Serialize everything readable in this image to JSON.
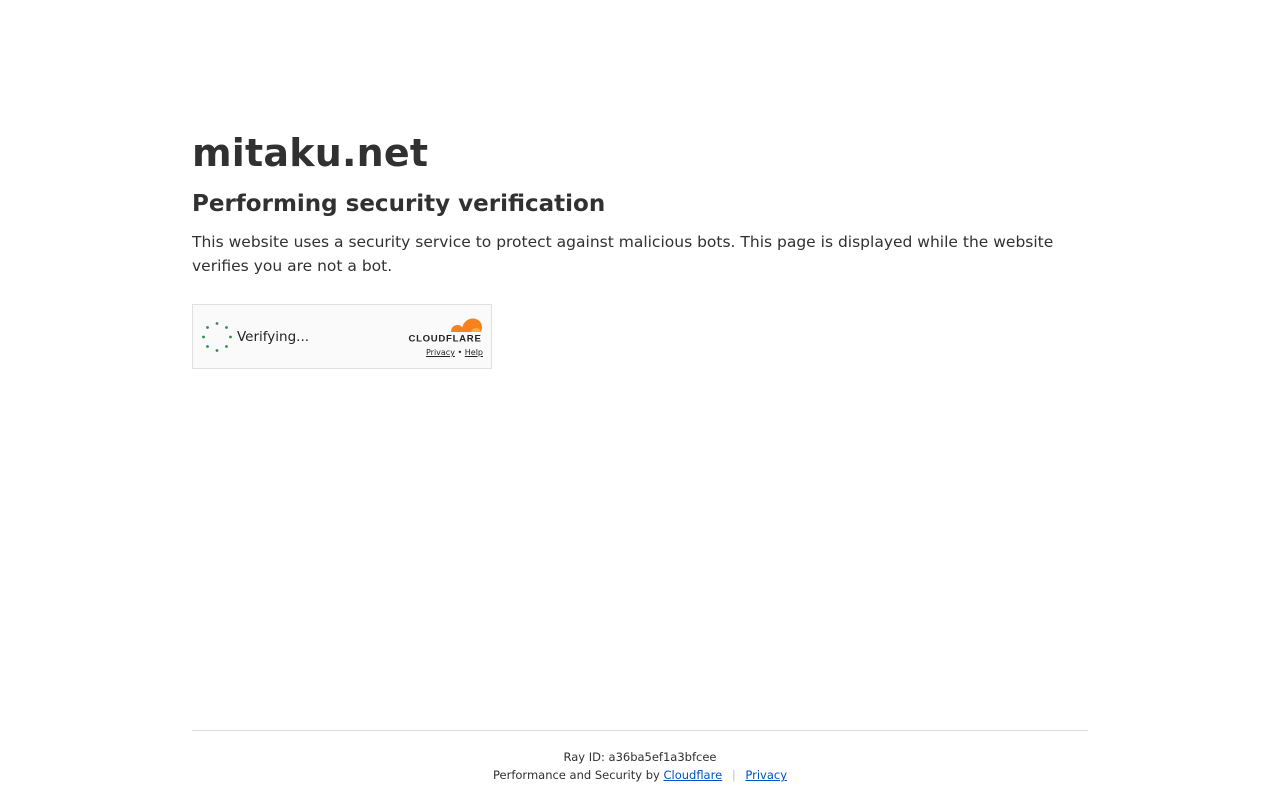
{
  "site": {
    "domain": "mitaku.net",
    "heading": "Performing security verification",
    "description": "This website uses a security service to protect against malicious bots. This page is displayed while the website verifies you are not a bot."
  },
  "widget": {
    "status_text": "Verifying...",
    "brand_icon": "cloudflare-logo",
    "brand_text": "CLOUDFLARE",
    "privacy_label": "Privacy",
    "link_separator": "•",
    "help_label": "Help",
    "spinner_icon": "spinner-icon",
    "spinner_color": "#2f8f4e",
    "brand_color": "#f6821f"
  },
  "footer": {
    "ray_label": "Ray ID:",
    "ray_id": "a36ba5ef1a3bfcee",
    "performance_prefix": "Performance and Security by",
    "cloudflare_link": "Cloudflare",
    "separator": "|",
    "privacy_link": "Privacy",
    "link_color": "#0051c3"
  }
}
